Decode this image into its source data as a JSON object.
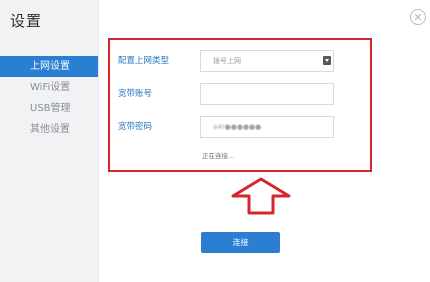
{
  "window": {
    "title": "设置",
    "close_symbol": "✕"
  },
  "sidebar": {
    "items": [
      {
        "label": "上网设置",
        "active": true
      },
      {
        "label": "WiFi设置",
        "active": false
      },
      {
        "label": "USB管理",
        "active": false
      },
      {
        "label": "其他设置",
        "active": false
      }
    ]
  },
  "form": {
    "connection_type": {
      "label": "配置上网类型",
      "value": "拨号上网"
    },
    "account": {
      "label": "宽带账号",
      "value": ""
    },
    "password": {
      "label": "宽带密码",
      "value": "a4r●●●●●●"
    },
    "status_text": "正在连接..."
  },
  "connect_button": {
    "label": "连接"
  },
  "colors": {
    "accent": "#2a7fd3",
    "highlight_border": "#d6262b",
    "label_text": "#2a78c4",
    "sidebar_bg": "#f1f2f4"
  }
}
